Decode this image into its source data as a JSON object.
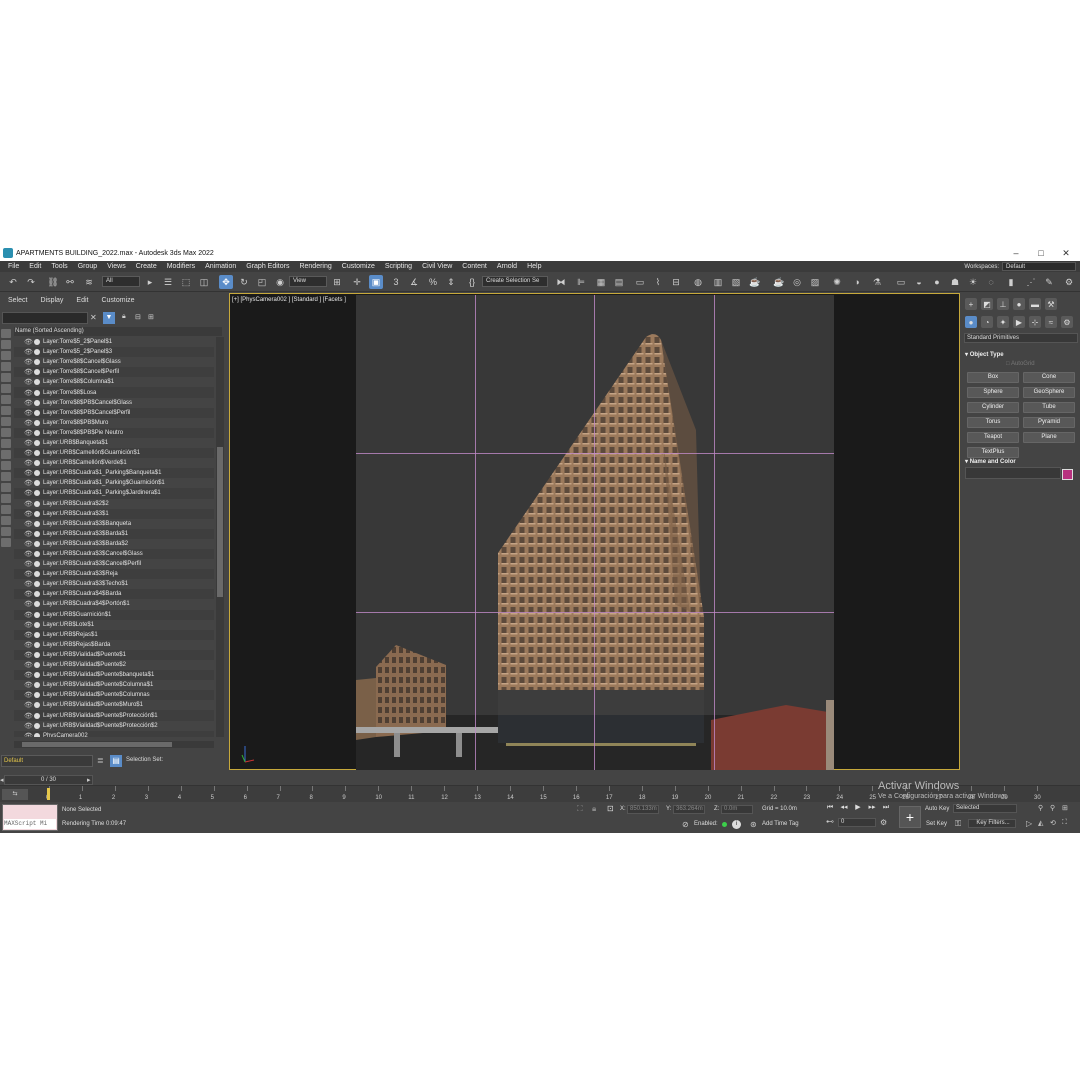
{
  "window": {
    "title": "APARTMENTS BUILDING_2022.max - Autodesk 3ds Max 2022",
    "minimize": "–",
    "maximize": "□",
    "close": "✕"
  },
  "menubar": {
    "items": [
      "File",
      "Edit",
      "Tools",
      "Group",
      "Views",
      "Create",
      "Modifiers",
      "Animation",
      "Graph Editors",
      "Rendering",
      "Customize",
      "Scripting",
      "Civil View",
      "Content",
      "Arnold",
      "Help"
    ],
    "workspaces_label": "Workspaces:",
    "workspace_value": "Default"
  },
  "toolbar": {
    "filter_value": "All",
    "view_value": "View",
    "selection_set_placeholder": "Create Selection Se"
  },
  "scene_explorer": {
    "tabs": [
      "Select",
      "Display",
      "Edit",
      "Customize"
    ],
    "column_header": "Name (Sorted Ascending)",
    "layers": [
      "Layer:Torre$5_2$Panel$1",
      "Layer:Torre$5_2$Panel$3",
      "Layer:Torre$8$Cancel$Glass",
      "Layer:Torre$8$Cancel$Perfil",
      "Layer:Torre$8$Columna$1",
      "Layer:Torre$8$Losa",
      "Layer:Torre$8$PB$Cancel$Glass",
      "Layer:Torre$8$PB$Cancel$Perfil",
      "Layer:Torre$8$PB$Muro",
      "Layer:Torre$8$PB$Pie Neutro",
      "Layer:URB$Banqueta$1",
      "Layer:URB$Camellón$Guarnición$1",
      "Layer:URB$Camellón$Verde$1",
      "Layer:URB$Cuadra$1_Parking$Banqueta$1",
      "Layer:URB$Cuadra$1_Parking$Guarnición$1",
      "Layer:URB$Cuadra$1_Parking$Jardinera$1",
      "Layer:URB$Cuadra$2$2",
      "Layer:URB$Cuadra$3$1",
      "Layer:URB$Cuadra$3$Banqueta",
      "Layer:URB$Cuadra$3$Barda$1",
      "Layer:URB$Cuadra$3$Barda$2",
      "Layer:URB$Cuadra$3$Cancel$Glass",
      "Layer:URB$Cuadra$3$Cancel$Perfil",
      "Layer:URB$Cuadra$3$Reja",
      "Layer:URB$Cuadra$3$Techo$1",
      "Layer:URB$Cuadra$4$Barda",
      "Layer:URB$Cuadra$4$Portón$1",
      "Layer:URB$Guarnición$1",
      "Layer:URB$Lote$1",
      "Layer:URB$Rejas$1",
      "Layer:URB$Rejas$Barda",
      "Layer:URB$Vialidad$Puente$1",
      "Layer:URB$Vialidad$Puente$2",
      "Layer:URB$Vialidad$Puente$banqueta$1",
      "Layer:URB$Vialidad$Puente$Columna$1",
      "Layer:URB$Vialidad$Puente$Columnas",
      "Layer:URB$Vialidad$Puente$Muro$1",
      "Layer:URB$Vialidad$Puente$Protección$1",
      "Layer:URB$Vialidad$Puente$Protección$2",
      "PhysCamera002"
    ],
    "layer_dropdown": "Default",
    "selection_set_label": "Selection Set:"
  },
  "viewport": {
    "label": "[+] [PhysCamera002 ] [Standard ] [Facets ]"
  },
  "command_panel": {
    "category": "Standard Primitives",
    "object_type_title": "Object Type",
    "autogrid": "AutoGrid",
    "buttons": [
      "Box",
      "Cone",
      "Sphere",
      "GeoSphere",
      "Cylinder",
      "Tube",
      "Torus",
      "Pyramid",
      "Teapot",
      "Plane",
      "TextPlus"
    ],
    "name_color_title": "Name and Color",
    "object_color": "#b8327f"
  },
  "timeline": {
    "frame_counter": "0 / 30",
    "ticks": [
      "0",
      "1",
      "2",
      "3",
      "4",
      "5",
      "6",
      "7",
      "8",
      "9",
      "10",
      "11",
      "12",
      "13",
      "14",
      "15",
      "16",
      "17",
      "18",
      "19",
      "20",
      "21",
      "22",
      "23",
      "24",
      "25",
      "26",
      "27",
      "28",
      "29",
      "30"
    ],
    "current_frame": 0
  },
  "status": {
    "maxscript_label": "MAXScript Mi",
    "selection": "None Selected",
    "render_time": "Rendering Time  0:09:47",
    "x_label": "X:",
    "x_value": "850.133m",
    "y_label": "Y:",
    "y_value": "363.264m",
    "z_label": "Z:",
    "z_value": "0.0m",
    "grid": "Grid = 10.0m",
    "enabled_label": "Enabled:",
    "add_time_tag": "Add Time Tag",
    "auto_key": "Auto Key",
    "key_mode_value": "Selected",
    "set_key": "Set Key",
    "key_filters": "Key Filters...",
    "frame_field": "0"
  },
  "watermark": {
    "line1": "Activar Windows",
    "line2": "Ve a Configuración para activar Windows."
  }
}
